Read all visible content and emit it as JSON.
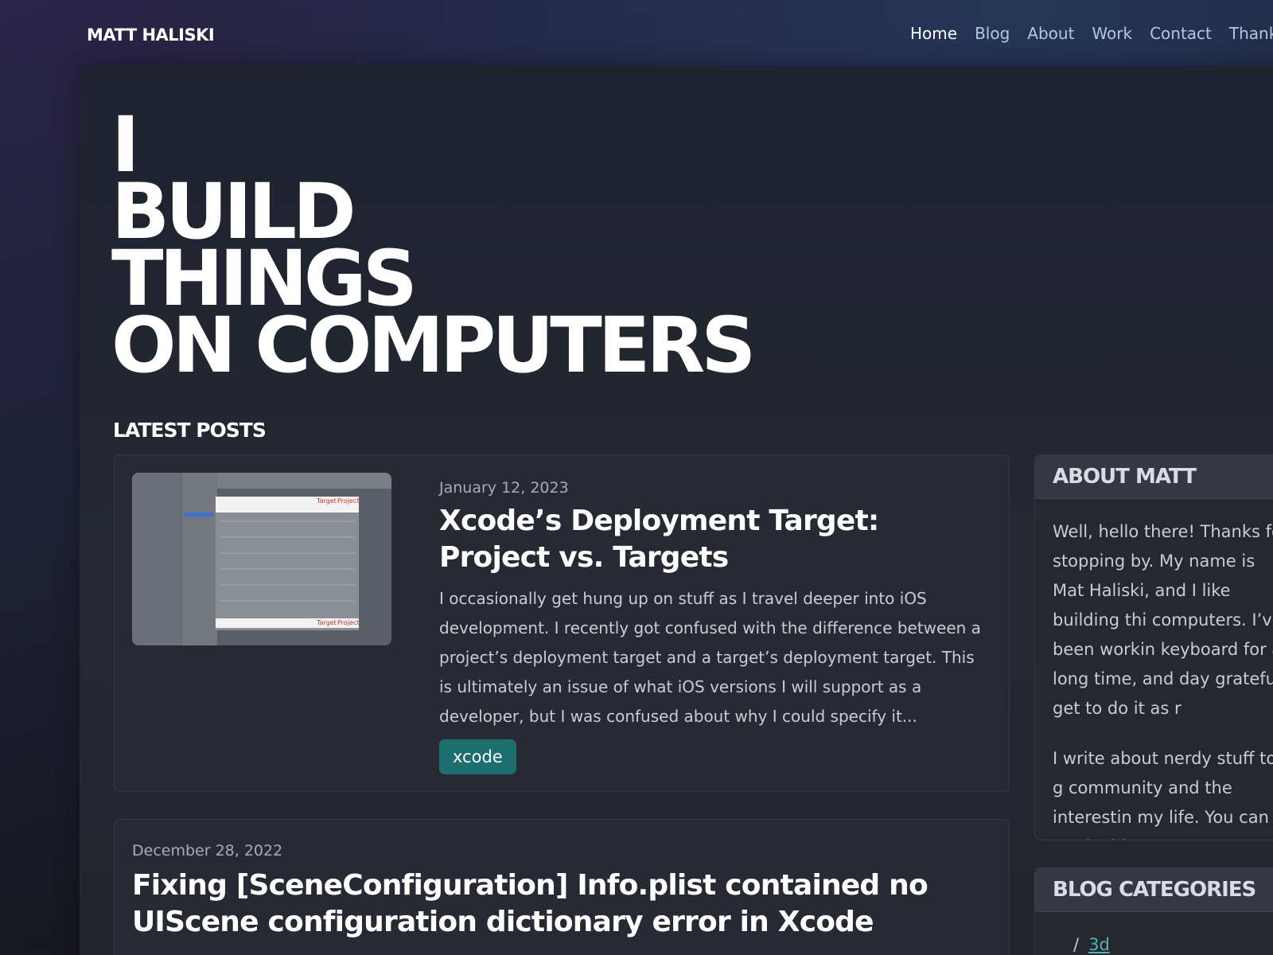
{
  "site": {
    "brand": "MATT HALISKI",
    "nav": [
      {
        "label": "Home",
        "active": true
      },
      {
        "label": "Blog",
        "active": false
      },
      {
        "label": "About",
        "active": false
      },
      {
        "label": "Work",
        "active": false
      },
      {
        "label": "Contact",
        "active": false
      },
      {
        "label": "Thank",
        "active": false
      }
    ]
  },
  "hero": {
    "lines": [
      "I",
      "BUILD",
      "THINGS",
      "ON COMPUTERS"
    ]
  },
  "latest_posts": {
    "heading": "LATEST POSTS",
    "posts": [
      {
        "date": "January 12, 2023",
        "title": "Xcode’s Deployment Target: Project vs. Targets",
        "excerpt": "I occasionally get hung up on stuff as I travel deeper into iOS development. I recently got confused with the difference between a project’s deployment target and a target’s deployment target. This is ultimately an issue of what iOS versions I will support as a developer, but I was confused about why I could specify it...",
        "tag": "xcode",
        "thumbnail_labels": [
          "Target",
          "Project"
        ]
      },
      {
        "date": "December 28, 2022",
        "title": "Fixing [SceneConfiguration] Info.plist contained no UIScene configuration dictionary error in Xcode"
      }
    ]
  },
  "sidebar": {
    "about": {
      "heading": "ABOUT MATT",
      "paragraphs": [
        "Well, hello there! Thanks for\nstopping by. My name is Mat\nHaliski, and I like building thi\ncomputers. I’ve been workin\nkeyboard for a long time, and\nday grateful I get to do it as r",
        "I write about nerdy stuff to g\ncommunity and the interestin\nmy life. You can read a bit m"
      ]
    },
    "categories": {
      "heading": "BLOG CATEGORIES",
      "items": [
        {
          "prefix": "/",
          "label": "3d"
        }
      ]
    }
  },
  "colors": {
    "tag_bg": "#1c6f6e",
    "link": "#4db6b2",
    "card_bg": "#282a33"
  }
}
